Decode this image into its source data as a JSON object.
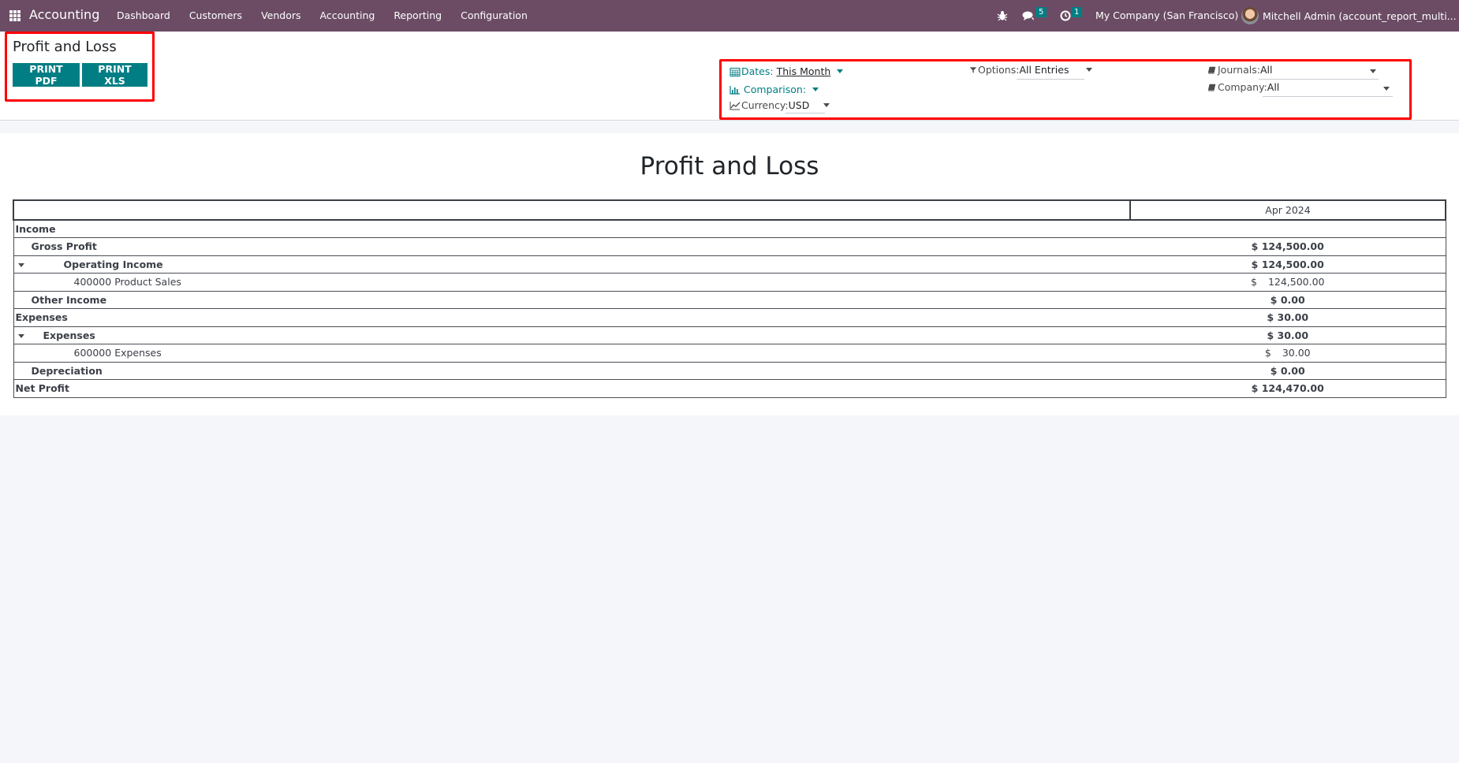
{
  "navbar": {
    "app_name": "Accounting",
    "menu": [
      "Dashboard",
      "Customers",
      "Vendors",
      "Accounting",
      "Reporting",
      "Configuration"
    ],
    "messages_count": "5",
    "activities_count": "1",
    "company": "My Company (San Francisco)",
    "user": "Mitchell Admin (account_report_multi..."
  },
  "control_panel": {
    "title": "Profit and Loss",
    "print_pdf": "PRINT PDF",
    "print_xls": "PRINT XLS",
    "filters": {
      "dates_label": "Dates:",
      "dates_value": "This Month",
      "comparison_label": "Comparison:",
      "currency_label": "Currency:",
      "currency_value": "USD",
      "options_label": "Options:",
      "options_value": "All Entries",
      "journals_label": "Journals:",
      "journals_value": "All",
      "company_label": "Company:",
      "company_value": "All"
    }
  },
  "report": {
    "title": "Profit and Loss",
    "column_header": "Apr 2024",
    "rows": [
      {
        "name": "Income",
        "amount": "",
        "level": 0,
        "bold": true
      },
      {
        "name": "Gross Profit",
        "amount": "$ 124,500.00",
        "level": 1,
        "bold": true
      },
      {
        "name": "Operating Income",
        "amount": "$ 124,500.00",
        "level": 2,
        "bold": true,
        "expanded": true
      },
      {
        "name": "400000 Product Sales",
        "amount": "124,500.00",
        "currency": "$",
        "level": 3,
        "bold": false
      },
      {
        "name": "Other Income",
        "amount": "$ 0.00",
        "level": 1,
        "bold": true
      },
      {
        "name": "Expenses",
        "amount": "$ 30.00",
        "level": 0,
        "bold": true
      },
      {
        "name": "Expenses",
        "amount": "$ 30.00",
        "level": 2,
        "bold": true,
        "expanded": true
      },
      {
        "name": "600000 Expenses",
        "amount": "30.00",
        "currency": "$",
        "level": 3,
        "bold": false
      },
      {
        "name": "Depreciation",
        "amount": "$ 0.00",
        "level": 1,
        "bold": true
      },
      {
        "name": "Net Profit",
        "amount": "$ 124,470.00",
        "level": 0,
        "bold": true
      }
    ]
  }
}
